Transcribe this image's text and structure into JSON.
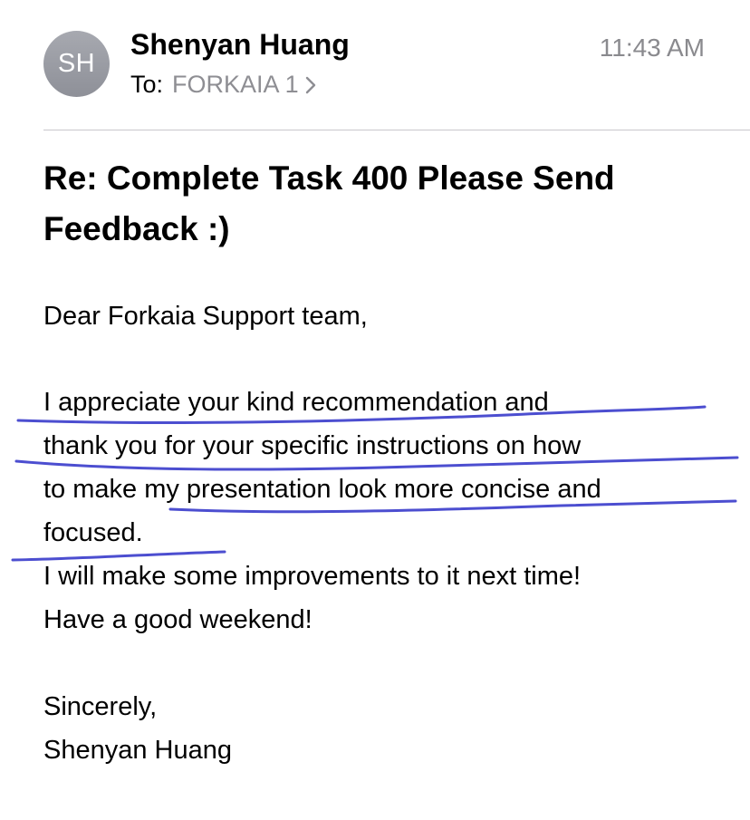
{
  "header": {
    "avatar_initials": "SH",
    "sender_name": "Shenyan Huang",
    "to_label": "To:",
    "recipient": "FORKAIA 1",
    "recipient_chevron_icon": "chevron-right-icon",
    "time": "11:43 AM"
  },
  "subject": "Re: Complete Task 400 Please Send Feedback :)",
  "body": {
    "lines": [
      "Dear Forkaia Support team,",
      "I appreciate your kind recommendation and",
      "thank you for your specific instructions on how",
      "to make my presentation look more concise and",
      "focused.",
      "I will make some improvements to it next time!",
      "Have a good weekend!",
      "Sincerely,",
      "Shenyan Huang"
    ]
  },
  "annotation": {
    "pen_color": "#4c4ed0"
  }
}
